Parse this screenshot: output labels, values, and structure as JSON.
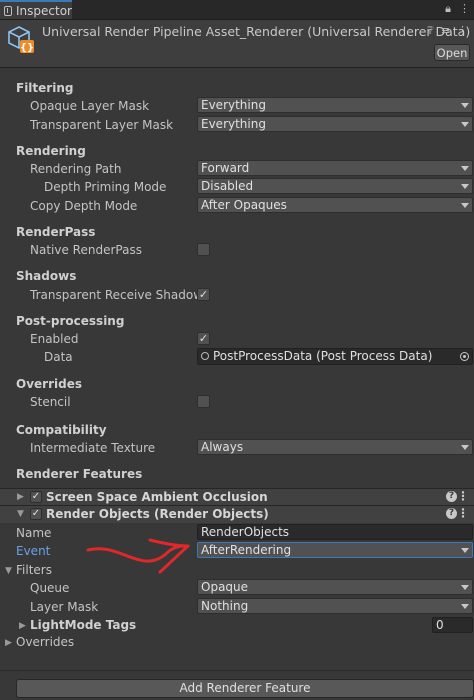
{
  "tab": {
    "label": "Inspector"
  },
  "header": {
    "title": "Universal Render Pipeline Asset_Renderer (Universal Renderer Data)",
    "open_label": "Open"
  },
  "filtering": {
    "title": "Filtering",
    "opaque_label": "Opaque Layer Mask",
    "opaque_value": "Everything",
    "transparent_label": "Transparent Layer Mask",
    "transparent_value": "Everything"
  },
  "rendering": {
    "title": "Rendering",
    "path_label": "Rendering Path",
    "path_value": "Forward",
    "depth_label": "Depth Priming Mode",
    "depth_value": "Disabled",
    "copy_label": "Copy Depth Mode",
    "copy_value": "After Opaques"
  },
  "renderpass": {
    "title": "RenderPass",
    "native_label": "Native RenderPass",
    "native_checked": false
  },
  "shadows": {
    "title": "Shadows",
    "trs_label": "Transparent Receive Shadows",
    "trs_checked": true
  },
  "post": {
    "title": "Post-processing",
    "enabled_label": "Enabled",
    "enabled_checked": true,
    "data_label": "Data",
    "data_value": "PostProcessData (Post Process Data)"
  },
  "overrides": {
    "title": "Overrides",
    "stencil_label": "Stencil",
    "stencil_checked": false
  },
  "compat": {
    "title": "Compatibility",
    "it_label": "Intermediate Texture",
    "it_value": "Always"
  },
  "features": {
    "title": "Renderer Features",
    "ssao": {
      "title": "Screen Space Ambient Occlusion",
      "checked": true
    },
    "ro": {
      "title": "Render Objects (Render Objects)",
      "checked": true,
      "name_label": "Name",
      "name_value": "RenderObjects",
      "event_label": "Event",
      "event_value": "AfterRendering",
      "filters_label": "Filters",
      "queue_label": "Queue",
      "queue_value": "Opaque",
      "layer_label": "Layer Mask",
      "layer_value": "Nothing",
      "tags_label": "LightMode Tags",
      "tags_value": "0",
      "overrides_label": "Overrides"
    },
    "add_label": "Add Renderer Feature"
  },
  "colors": {
    "accent": "#3a79bb",
    "annotation": "#e0282a",
    "event_label": "#6aa0e8"
  },
  "icons": {
    "tab": "inspector-icon",
    "lock": "lock-icon",
    "menu": "kebab-icon",
    "asset": "renderer-asset-icon",
    "help": "help-icon",
    "settings": "sliders-icon",
    "object": "scriptable-object-icon",
    "picker": "object-picker-icon"
  },
  "checkmark": "✓"
}
